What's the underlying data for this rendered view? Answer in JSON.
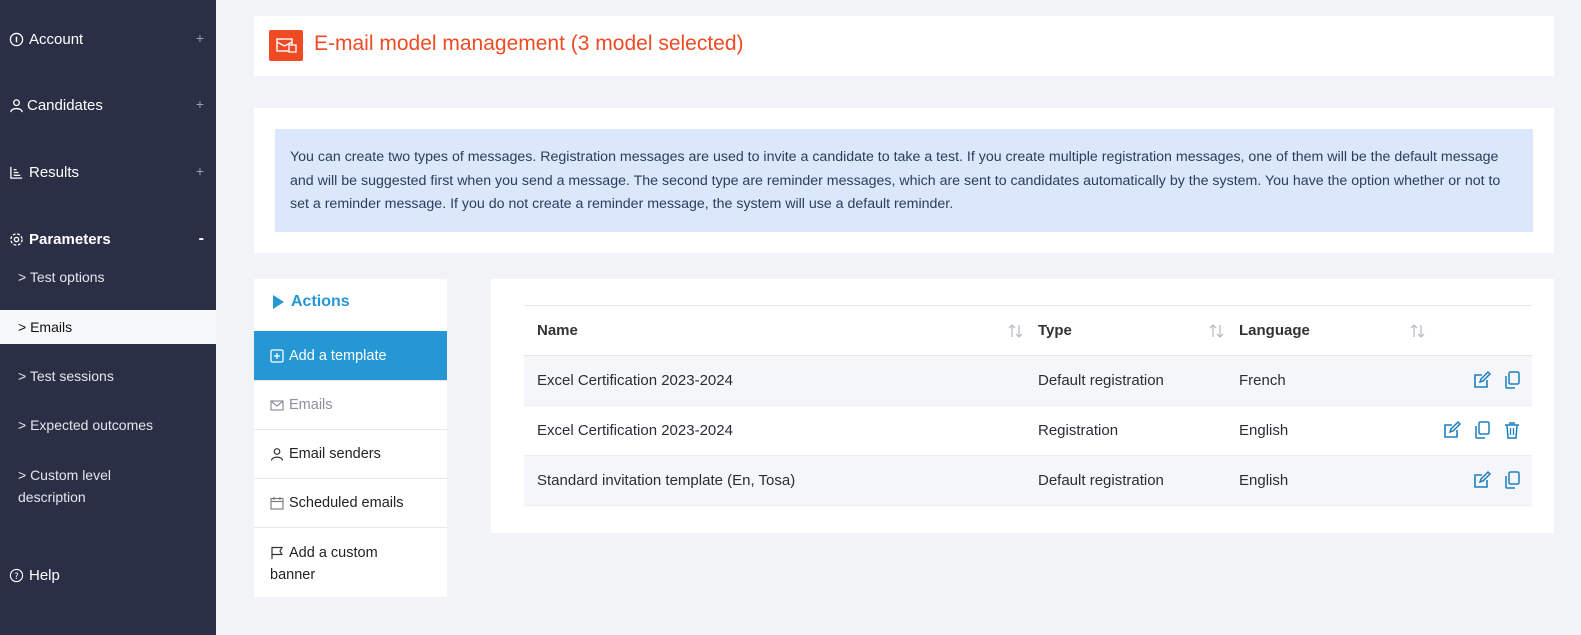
{
  "sidebar": {
    "sections": [
      {
        "label": "Account",
        "toggle": "+",
        "icon": "info-icon"
      },
      {
        "label": "Candidates",
        "toggle": "+",
        "icon": "user-icon"
      },
      {
        "label": "Results",
        "toggle": "+",
        "icon": "chart-icon"
      },
      {
        "label": "Parameters",
        "toggle": "-",
        "icon": "gear-icon"
      }
    ],
    "sub_items": [
      "> Test options",
      "> Emails",
      "> Test sessions",
      "> Expected outcomes",
      "> Custom level",
      "description"
    ],
    "help": {
      "label": "Help",
      "icon": "help-icon"
    }
  },
  "header": {
    "title": "E-mail model management (3 model selected)",
    "accent": "#ef4a23"
  },
  "info": {
    "text": "You can create two types of messages. Registration messages are used to invite a candidate to take a test. If you create multiple registration messages, one of them will be the default message and will be suggested first when you send a message. The second type are reminder messages, which are sent to candidates automatically by the system. You have the option whether or not to set a reminder message. If you do not create a reminder message, the system will use a default reminder."
  },
  "actions": {
    "title": "Actions",
    "items": [
      {
        "label": "Add a template",
        "icon": "plus-square-icon"
      },
      {
        "label": "Emails",
        "icon": "envelope-icon"
      },
      {
        "label": "Email senders",
        "icon": "user-icon"
      },
      {
        "label": "Scheduled emails",
        "icon": "calendar-icon"
      },
      {
        "label": "Add a custom",
        "label2": "banner",
        "icon": "flag-icon"
      }
    ]
  },
  "table": {
    "columns": [
      "Name",
      "Type",
      "Language"
    ],
    "rows": [
      {
        "name": "Excel Certification 2023-2024",
        "type": "Default registration",
        "language": "French"
      },
      {
        "name": "Excel Certification 2023-2024",
        "type": "Registration",
        "language": "English"
      },
      {
        "name": "Standard invitation template (En, Tosa)",
        "type": "Default registration",
        "language": "English"
      }
    ]
  },
  "colors": {
    "sidebar": "#2b2f45",
    "primary": "#2497d4",
    "info_bg": "#dbe7fb"
  }
}
